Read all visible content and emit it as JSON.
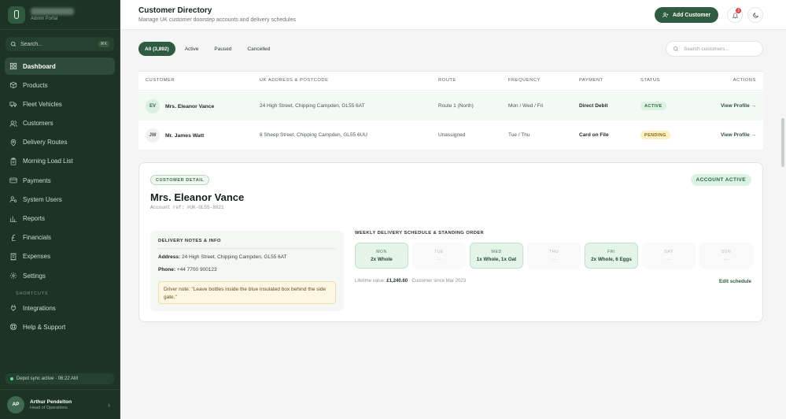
{
  "brand": {
    "subtitle": "Admin Portal"
  },
  "sidebar": {
    "search_placeholder": "Search...",
    "search_shortcut": "⌘K",
    "items": [
      {
        "label": "Dashboard",
        "icon": "dashboard-icon",
        "active": true
      },
      {
        "label": "Products",
        "icon": "box-icon"
      },
      {
        "label": "Fleet Vehicles",
        "icon": "truck-icon"
      },
      {
        "label": "Customers",
        "icon": "users-icon"
      },
      {
        "label": "Delivery Routes",
        "icon": "map-pin-icon"
      },
      {
        "label": "Morning Load List",
        "icon": "clipboard-icon"
      },
      {
        "label": "Payments",
        "icon": "credit-card-icon"
      },
      {
        "label": "System Users",
        "icon": "user-cog-icon"
      },
      {
        "label": "Reports",
        "icon": "bar-chart-icon"
      },
      {
        "label": "Financials",
        "icon": "pound-icon"
      },
      {
        "label": "Expenses",
        "icon": "receipt-icon"
      },
      {
        "label": "Settings",
        "icon": "gear-icon"
      }
    ],
    "shortcuts_heading": "SHORTCUTS",
    "shortcuts": [
      {
        "label": "Integrations",
        "icon": "plug-icon"
      },
      {
        "label": "Help & Support",
        "icon": "lifebuoy-icon"
      }
    ],
    "sync_status": "Depot sync active · 06:22 AM",
    "user": {
      "initials": "AP",
      "name": "Arthur Pendelton",
      "role": "Head of Operations"
    }
  },
  "header": {
    "title": "Customer Directory",
    "subtitle": "Manage UK customer doorstep accounts and delivery schedules",
    "add_button": "Add Customer",
    "notification_count": "3"
  },
  "filters": {
    "tabs": [
      "All (3,892)",
      "Active",
      "Paused",
      "Cancelled"
    ],
    "active_tab": "All (3,892)",
    "search_placeholder": "Search customers..."
  },
  "table": {
    "columns": [
      "CUSTOMER",
      "UK ADDRESS & POSTCODE",
      "ROUTE",
      "FREQUENCY",
      "PAYMENT",
      "STATUS",
      "ACTIONS"
    ],
    "rows": [
      {
        "initials": "EV",
        "name": "Mrs. Eleanor Vance",
        "address": "24 High Street, Chipping Campden, GL55 6AT",
        "route": "Route 1 (North)",
        "frequency": "Mon / Wed / Fri",
        "payment": "Direct Debit",
        "status": "ACTIVE",
        "action": "View Profile →"
      },
      {
        "initials": "JW",
        "name": "Mr. James Watt",
        "address": "8 Sheep Street, Chipping Campden, GL55 6UU",
        "route": "Unassigned",
        "frequency": "Tue / Thu",
        "payment": "Card on File",
        "status": "PENDING",
        "action": "View Profile →"
      }
    ]
  },
  "detail": {
    "tag": "CUSTOMER DETAIL",
    "account_badge": "ACCOUNT ACTIVE",
    "name": "Mrs. Eleanor Vance",
    "ref": "Account ref: #UK-GL55-8821",
    "notes_title": "DELIVERY NOTES & INFO",
    "address_label": "Address:",
    "address": "24 High Street, Chipping Campden, GL55 6AT",
    "phone_label": "Phone:",
    "phone": "+44 7700 900123",
    "driver_note": "Driver note: \"Leave bottles inside the blue insulated box behind the side gate.\"",
    "schedule_title": "WEEKLY DELIVERY SCHEDULE & STANDING ORDER",
    "days": [
      {
        "day": "MON",
        "order": "2x Whole",
        "on": true
      },
      {
        "day": "TUE",
        "order": "—",
        "on": false
      },
      {
        "day": "WED",
        "order": "1x Whole, 1x Oat",
        "on": true
      },
      {
        "day": "THU",
        "order": "—",
        "on": false
      },
      {
        "day": "FRI",
        "order": "2x Whole, 6 Eggs",
        "on": true
      },
      {
        "day": "SAT",
        "order": "—",
        "on": false
      },
      {
        "day": "SUN",
        "order": "—",
        "on": false
      }
    ],
    "lifetime_label": "Lifetime value:",
    "lifetime_value": "£1,240.60",
    "customer_since": "· Customer since Mar 2023",
    "edit_link": "Edit schedule"
  },
  "colors": {
    "sidebar_bg": "#1d3326",
    "accent": "#2f5b41",
    "active_badge": "#dcf2e2",
    "pending_badge": "#fdf0c6"
  }
}
